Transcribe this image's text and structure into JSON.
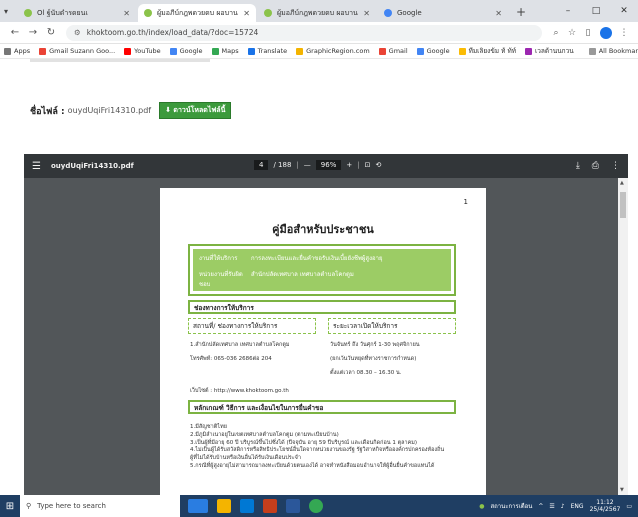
{
  "tabs": [
    {
      "label": "Ol ฐ์นับดำรดยนเ",
      "active": false
    },
    {
      "label": "ผู้มอภีบ์กฎพดวยดบ ผอบาน",
      "active": true
    },
    {
      "label": "ผู้มอภีบ์กฎพดวยดบ ผอบาน",
      "active": false
    },
    {
      "label": "Google",
      "active": false
    }
  ],
  "window": {
    "minimize": "–",
    "maximize": "□",
    "close": "✕"
  },
  "address": {
    "url": "khoktoom.go.th/index/load_data/?doc=15724"
  },
  "bookmarks": [
    "Apps",
    "Gmail Suzann Goo...",
    "YouTube",
    "Google",
    "Maps",
    "Translate",
    "GraphicRegion.com",
    "Gmail",
    "Google",
    "ทีมเลิยงข้ม ท้ ท้ท์",
    "เวลด้านนกวน"
  ],
  "bookmarks_all": "All Bookmarks",
  "file": {
    "label": "ชื่อไฟล์ :",
    "name": "ouydUqiFri14310.pdf",
    "download": "⬇ ดาวน์โหลดไฟล์นี้"
  },
  "pdf": {
    "filename": "ouydUqiFri14310.pdf",
    "page_current": "4",
    "page_total": "/ 188",
    "zoom": "96%",
    "page_number": "1",
    "title": "คู่มือสำหรับประชาชน",
    "box1": [
      {
        "label": "งานที่ให้บริการ",
        "value": "การลงทะเบียนและยื่นคำขอรับเงินเบี้ยยังชีพผู้สูงอายุ"
      },
      {
        "label": "หน่วยงานที่รับผิดชอบ",
        "value": "สำนักปลัดเทศบาล เทศบาลตำบลโคกตูม"
      }
    ],
    "section1": "ช่องทางการให้บริการ",
    "col1": "สถานที่/ ช่องทางการให้บริการ",
    "col2": "ระยะเวลาเปิดให้บริการ",
    "loc1": "1.สำนักปลัดเทศบาล เทศบาลตำบลโคกตูม",
    "loc2": "โทรศัพท์: 065-036 2686ต่อ 204",
    "time1": "วันจันทร์ ถึง วันศุกร์ 1-30 พฤศจิกายน",
    "time2": "(ยกเว้นวันหยุดที่ทางราชการกำหนด)",
    "time3": "ตั้งแต่เวลา 08.30 – 16.30 น.",
    "website": "เว็บไซต์ : http://www.khoktoom.go.th",
    "section2": "หลักเกณฑ์ วิธีการ และเงื่อนไขในการยื่นคำขอ",
    "lines": [
      "1.มีสัญชาติไทย",
      "2.มีภูมิลำเนาอยู่ในเขตเทศบาลตำบลโคกตูม (ตามทะเบียนบ้าน)",
      "3.เป็นผู้ที่มีอายุ 60 ปี บริบูรณ์ขึ้นไปซึ่งได้ (ปีจจุบัน อายุ 59 ปีบริบูรณ์ และเดือนกิดก่อน 1 ตุลาคม)",
      "4.ไม่เป็นผู้ได้รับสวัสดิการหรือสิทธิประโยชน์อื่นใดจากหน่วยงานของรัฐ รัฐวิสาหกิจหรือองค์กรปกครองท้องถิ่น",
      "ผู้ที่ไม่ได้รับบ้านหรือเงินอื่นได้รับเงินเดือนประจำ",
      "5.กรณีที่ผู้สูงอายุไม่สามารถมาลงทะเบียนด้วยตนเองได้ อาจทำหนังสือมอบอำนาจให้ผู้อื่นยื่นคำขอแทนได้"
    ]
  },
  "taskbar": {
    "search_placeholder": "Type here to search",
    "tray_text": "สถานะการเตือน",
    "lang": "ENG",
    "time": "11:12",
    "date": "25/4/2567"
  }
}
